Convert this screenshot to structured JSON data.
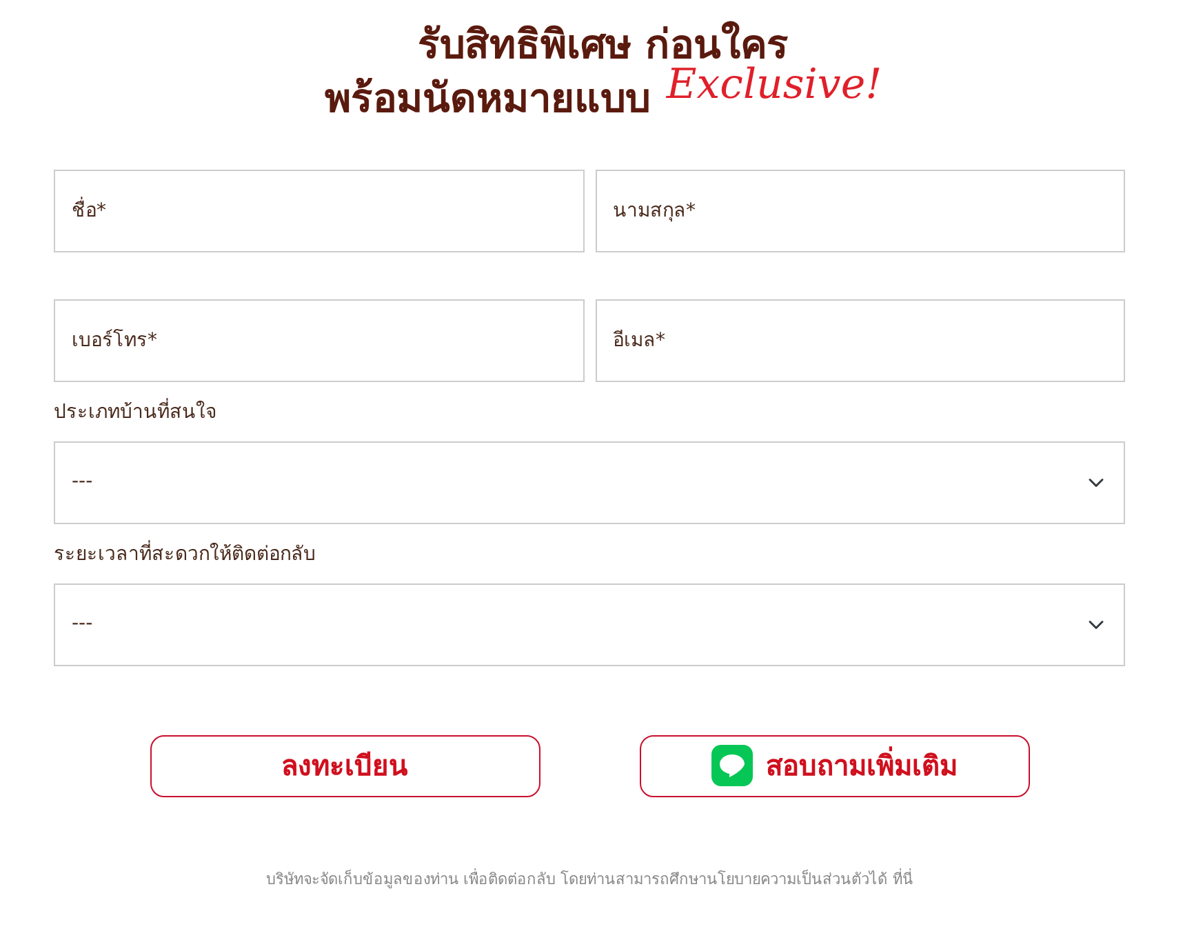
{
  "heading": {
    "line_1": "รับสิทธิพิเศษ ก่อนใคร",
    "line_2": "พร้อมนัดหมายแบบ",
    "accent": "Exclusive!"
  },
  "fields": [
    {
      "placeholder": "ชื่อ*"
    },
    {
      "placeholder": "นามสกุล*"
    },
    {
      "placeholder": "เบอร์โทร*"
    },
    {
      "placeholder": "อีเมล*"
    }
  ],
  "selects": [
    {
      "label": "ประเภทบ้านที่สนใจ",
      "value": "---"
    },
    {
      "label": "ระยะเวลาที่สะดวกให้ติดต่อกลับ",
      "value": "---"
    }
  ],
  "buttons": [
    {
      "kind": "plain",
      "label": "ลงทะเบียน"
    },
    {
      "kind": "line",
      "label": "สอบถามเพิ่มเติม"
    }
  ],
  "footer": {
    "text": "บริษัทจะจัดเก็บข้อมูลของท่าน เพื่อติดต่อกลับ โดยท่านสามารถศึกษานโยบายความเป็นส่วนตัวได้",
    "link": "ที่นี่"
  }
}
